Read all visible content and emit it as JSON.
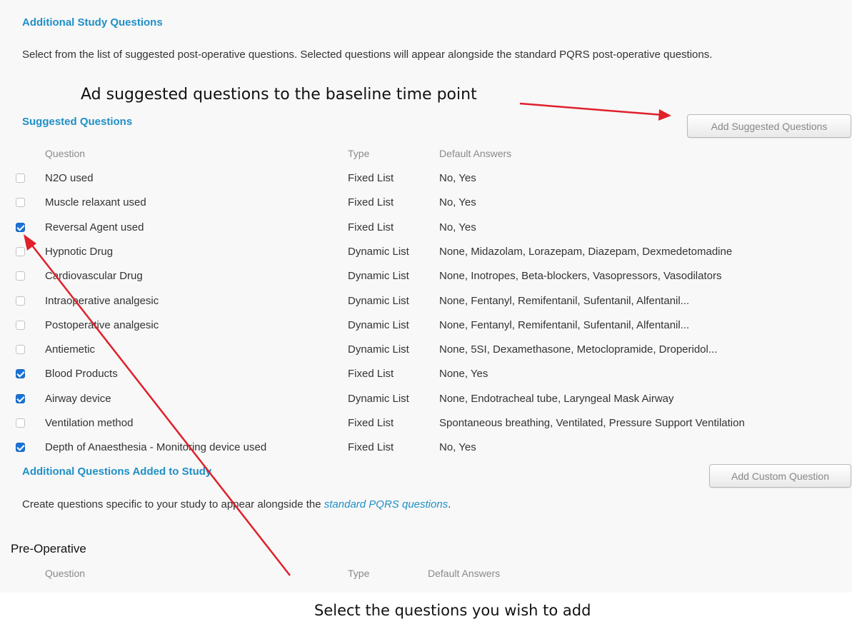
{
  "section": {
    "title": "Additional Study Questions",
    "description": "Select from the list of suggested post-operative questions. Selected questions will appear alongside the standard PQRS post-operative questions."
  },
  "callouts": {
    "top": "Ad suggested questions to the baseline time point",
    "bottom": "Select the questions you wish to add"
  },
  "suggested": {
    "title": "Suggested Questions",
    "add_button": "Add Suggested Questions",
    "columns": {
      "question": "Question",
      "type": "Type",
      "answers": "Default Answers"
    },
    "rows": [
      {
        "question": "N2O used",
        "type": "Fixed List",
        "answers": "No, Yes",
        "checked": false
      },
      {
        "question": "Muscle relaxant used",
        "type": "Fixed List",
        "answers": "No, Yes",
        "checked": false
      },
      {
        "question": "Reversal Agent used",
        "type": "Fixed List",
        "answers": "No, Yes",
        "checked": true
      },
      {
        "question": "Hypnotic Drug",
        "type": "Dynamic List",
        "answers": "None, Midazolam, Lorazepam, Diazepam, Dexmedetomadine",
        "checked": false
      },
      {
        "question": "Cardiovascular Drug",
        "type": "Dynamic List",
        "answers": "None, Inotropes, Beta-blockers, Vasopressors, Vasodilators",
        "checked": false
      },
      {
        "question": "Intraoperative analgesic",
        "type": "Dynamic List",
        "answers": "None, Fentanyl, Remifentanil, Sufentanil, Alfentanil...",
        "checked": false
      },
      {
        "question": "Postoperative analgesic",
        "type": "Dynamic List",
        "answers": "None, Fentanyl, Remifentanil, Sufentanil, Alfentanil...",
        "checked": false
      },
      {
        "question": "Antiemetic",
        "type": "Dynamic List",
        "answers": "None, 5SI, Dexamethasone, Metoclopramide, Droperidol...",
        "checked": false
      },
      {
        "question": "Blood Products",
        "type": "Fixed List",
        "answers": "None, Yes",
        "checked": true
      },
      {
        "question": "Airway device",
        "type": "Dynamic List",
        "answers": "None, Endotracheal tube, Laryngeal Mask Airway",
        "checked": true
      },
      {
        "question": "Ventilation method",
        "type": "Fixed List",
        "answers": "Spontaneous breathing, Ventilated, Pressure Support Ventilation",
        "checked": false
      },
      {
        "question": "Depth of Anaesthesia - Monitoring device used",
        "type": "Fixed List",
        "answers": "No, Yes",
        "checked": true
      }
    ]
  },
  "additional": {
    "title": "Additional Questions Added to Study",
    "add_button": "Add Custom Question",
    "text_before": "Create questions specific to your study to appear alongside the ",
    "link_text": "standard PQRS questions",
    "text_after": "."
  },
  "preop": {
    "title": "Pre-Operative",
    "columns": {
      "question": "Question",
      "type": "Type",
      "answers": "Default Answers"
    }
  },
  "colors": {
    "accent": "#1f8fc6",
    "arrow": "#e0202a",
    "checkbox": "#1a73d6"
  }
}
